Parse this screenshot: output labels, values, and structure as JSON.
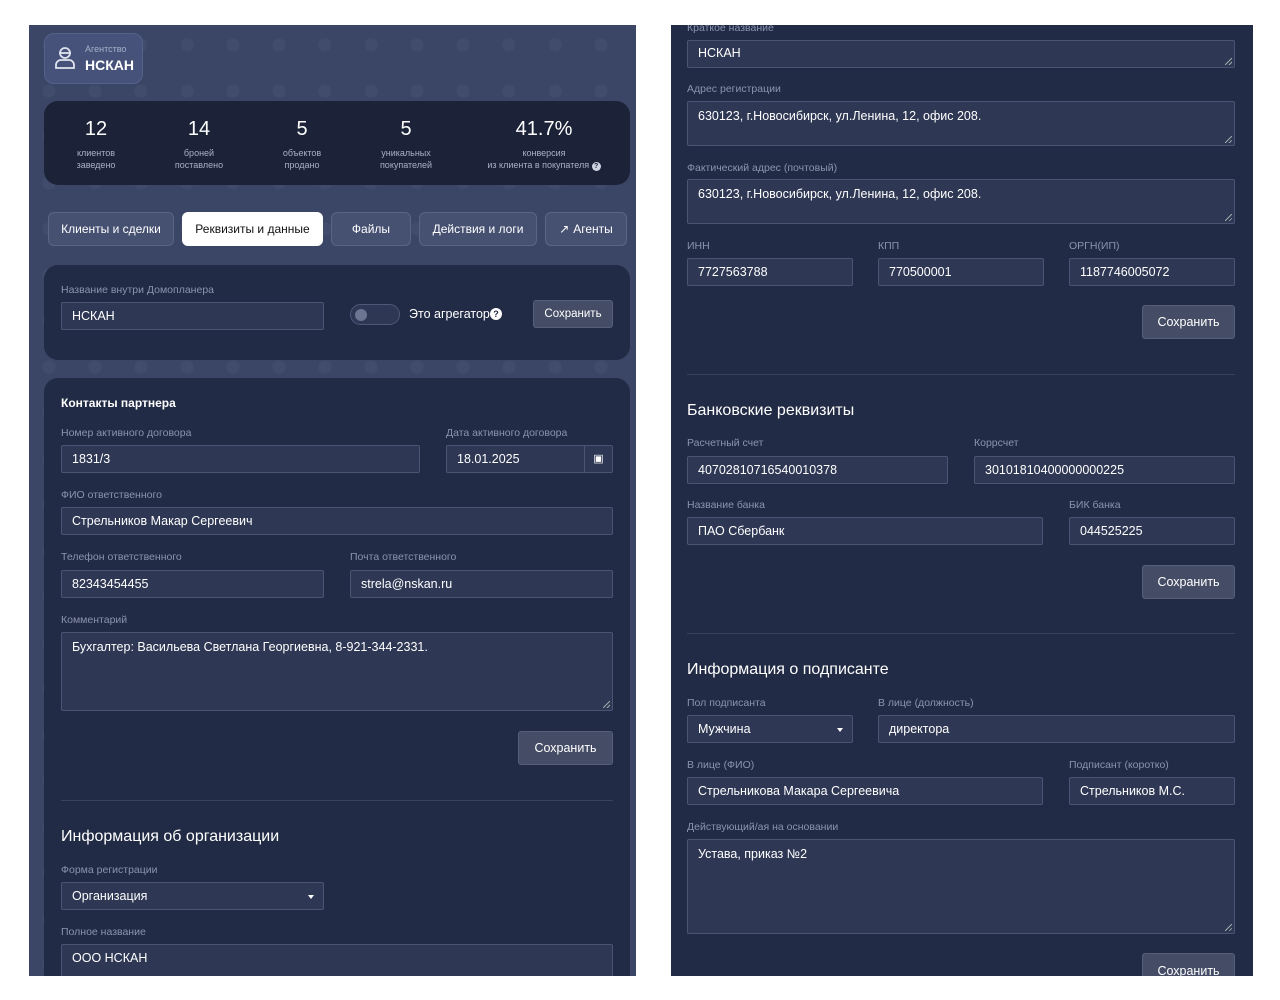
{
  "agency": {
    "label": "Агентство",
    "name": "НСКАН"
  },
  "stats": [
    {
      "value": "12",
      "line1": "клиентов",
      "line2": "заведено"
    },
    {
      "value": "14",
      "line1": "броней",
      "line2": "поставлено"
    },
    {
      "value": "5",
      "line1": "объектов",
      "line2": "продано"
    },
    {
      "value": "5",
      "line1": "уникальных",
      "line2": "покупателей"
    },
    {
      "value": "41.7%",
      "line1": "конверсия",
      "line2": "из клиента в покупателя"
    }
  ],
  "tabs": [
    "Клиенты и сделки",
    "Реквизиты и данные",
    "Файлы",
    "Действия и логи",
    "Агенты"
  ],
  "save": "Сохранить",
  "general": {
    "name_label": "Название внутри Домопланера",
    "name_value": "НСКАН",
    "aggregator_label": "Это агрегатор",
    "aggregator_on": false
  },
  "contacts": {
    "title": "Контакты партнера",
    "contract_label": "Номер активного договора",
    "contract_value": "1831/3",
    "date_label": "Дата активного договора",
    "date_value": "18.01.2025",
    "fio_label": "ФИО ответственного",
    "fio_value": "Стрельников Макар Сергеевич",
    "phone_label": "Телефон ответственного",
    "phone_value": "82343454455",
    "email_label": "Почта ответственного",
    "email_value": "strela@nskan.ru",
    "comment_label": "Комментарий",
    "comment_value": "Бухгалтер: Васильева Светлана Георгиевна, 8-921-344-2331."
  },
  "org": {
    "title": "Информация об организации",
    "form_label": "Форма регистрации",
    "form_value": "Организация",
    "full_label": "Полное название",
    "full_value": "ООО НСКАН",
    "short_label": "Краткое название",
    "short_value": "НСКАН",
    "reg_label": "Адрес регистрации",
    "reg_value": "630123, г.Новосибирск, ул.Ленина, 12, офис 208.",
    "fact_label": "Фактический адрес (почтовый)",
    "fact_value": "630123, г.Новосибирск, ул.Ленина, 12, офис 208.",
    "inn_label": "ИНН",
    "inn_value": "7727563788",
    "kpp_label": "КПП",
    "kpp_value": "770500001",
    "ogrn_label": "ОРГН(ИП)",
    "ogrn_value": "1187746005072"
  },
  "bank": {
    "title": "Банковские реквизиты",
    "account_label": "Расчетный счет",
    "account_value": "40702810716540010378",
    "corr_label": "Коррсчет",
    "corr_value": "30101810400000000225",
    "name_label": "Название банка",
    "name_value": "ПАО Сбербанк",
    "bik_label": "БИК банка",
    "bik_value": "044525225"
  },
  "signer": {
    "title": "Информация о подписанте",
    "gender_label": "Пол подписанта",
    "gender_value": "Мужчина",
    "position_label": "В лице (должность)",
    "position_value": "директора",
    "fio_label": "В лице (ФИО)",
    "fio_value": "Стрельникова Макара Сергеевича",
    "short_label": "Подписант (коротко)",
    "short_value": "Стрельников М.С.",
    "basis_label": "Действующий/ая на основании",
    "basis_value": "Устава, приказ №2"
  }
}
